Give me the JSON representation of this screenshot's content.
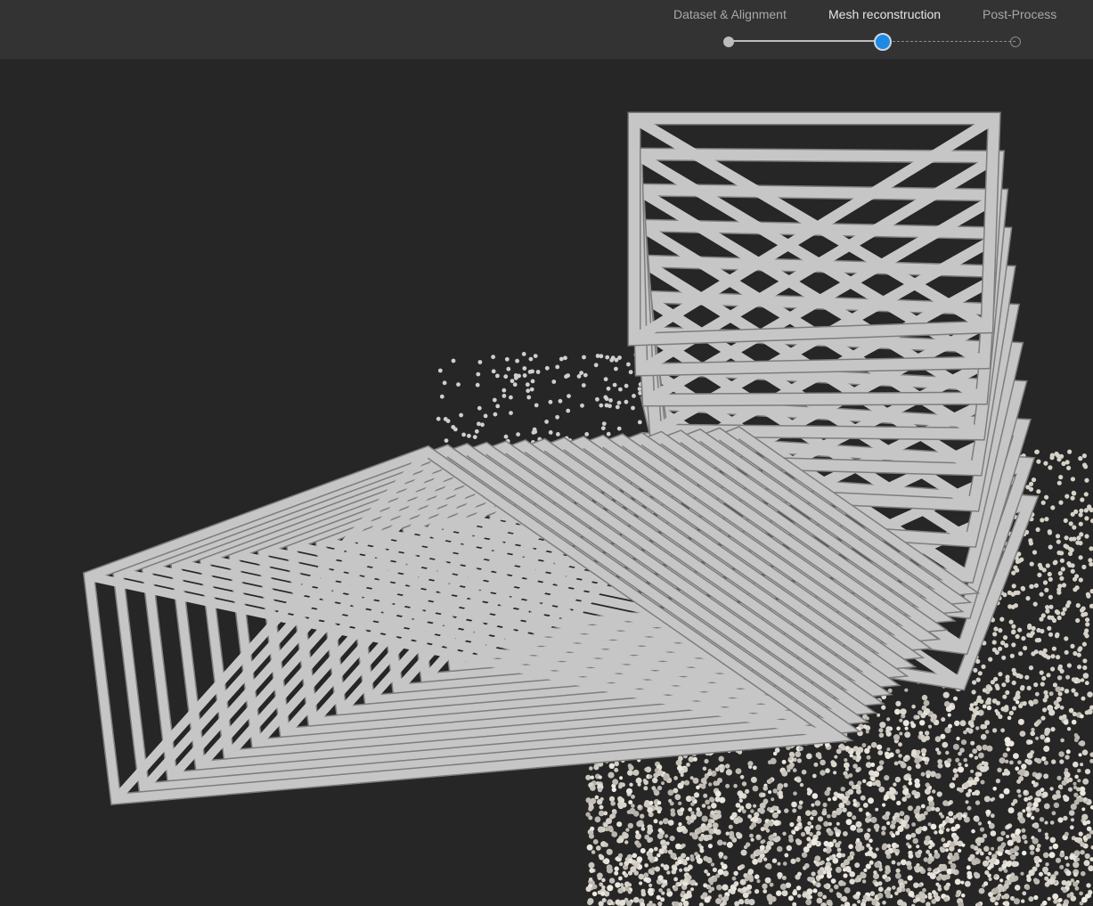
{
  "workflow": {
    "steps": [
      {
        "label": "Dataset & Alignment",
        "state": "completed"
      },
      {
        "label": "Mesh reconstruction",
        "state": "active"
      },
      {
        "label": "Post-Process",
        "state": "pending"
      }
    ]
  },
  "viewport": {
    "description_icon": "3d-scene-icon",
    "object": "sparse-point-cloud-with-camera-frustums"
  },
  "colors": {
    "topbar_bg": "#333333",
    "viewport_bg": "#262626",
    "active_step": "#1e88e5",
    "completed_step": "#bdbdbd",
    "pending_step": "#8a8a8a",
    "camera_frame": "#c4c4c4",
    "points": "#dcd8cf"
  }
}
